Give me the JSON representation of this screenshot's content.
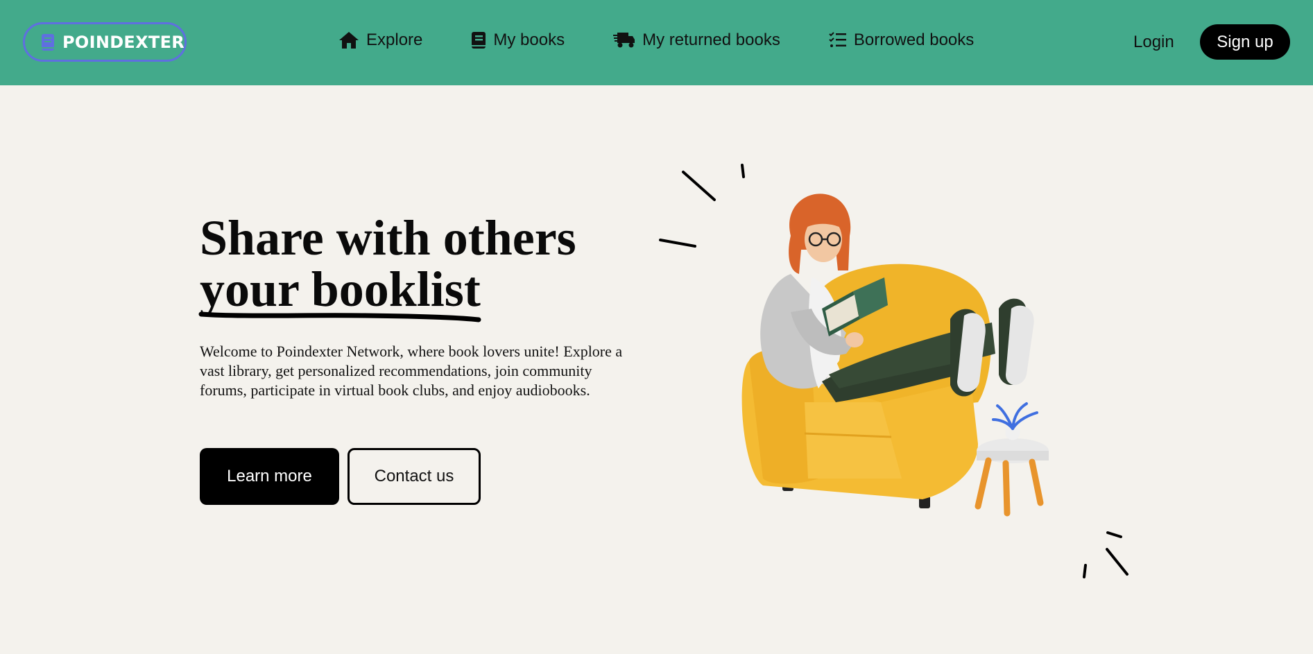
{
  "navbar": {
    "brand": {
      "name": "POINDEXTER",
      "icon": "book-icon"
    },
    "links": [
      {
        "label": "Explore",
        "icon": "home-icon"
      },
      {
        "label": "My books",
        "icon": "book-icon"
      },
      {
        "label": "My returned books",
        "icon": "truck-icon"
      },
      {
        "label": "Borrowed books",
        "icon": "checklist-icon"
      }
    ],
    "login_label": "Login",
    "signup_label": "Sign up"
  },
  "hero": {
    "title_line1": "Share with others",
    "title_line2": "your booklist",
    "description": "Welcome to Poindexter Network, where book lovers unite! Explore a vast library, get personalized recommendations, join community forums, participate in virtual book clubs, and enjoy audiobooks.",
    "learn_more_label": "Learn more",
    "contact_label": "Contact us",
    "illustration": "person-reading-in-armchair-illustration"
  },
  "colors": {
    "navbar_bg": "#43aa8b",
    "page_bg": "#f4f2ed",
    "brand_border": "#5f6fe0",
    "armchair": "#f2b92e"
  }
}
